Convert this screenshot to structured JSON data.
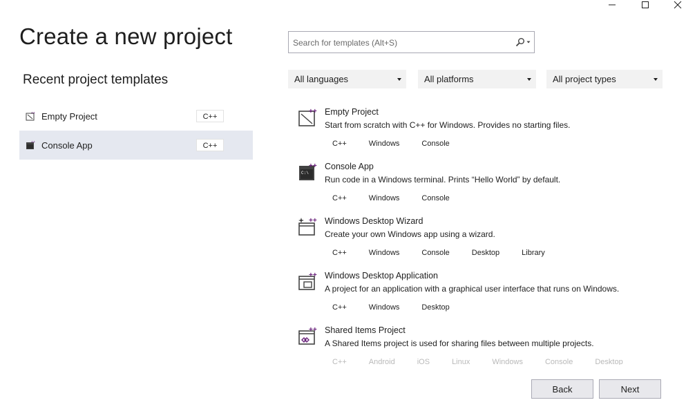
{
  "page": {
    "title": "Create a new project"
  },
  "recent": {
    "heading": "Recent project templates",
    "items": [
      {
        "label": "Empty Project",
        "badge": "C++",
        "icon": "empty-project-icon"
      },
      {
        "label": "Console App",
        "badge": "C++",
        "icon": "console-app-icon",
        "selected": true
      }
    ]
  },
  "search": {
    "placeholder": "Search for templates (Alt+S)",
    "value": ""
  },
  "filters": {
    "language": "All languages",
    "platform": "All platforms",
    "project_type": "All project types"
  },
  "templates": [
    {
      "name": "Empty Project",
      "description": "Start from scratch with C++ for Windows. Provides no starting files.",
      "tags": [
        "C++",
        "Windows",
        "Console"
      ],
      "icon": "empty-project-icon"
    },
    {
      "name": "Console App",
      "description": "Run code in a Windows terminal. Prints “Hello World” by default.",
      "tags": [
        "C++",
        "Windows",
        "Console"
      ],
      "icon": "console-app-icon"
    },
    {
      "name": "Windows Desktop Wizard",
      "description": "Create your own Windows app using a wizard.",
      "tags": [
        "C++",
        "Windows",
        "Console",
        "Desktop",
        "Library"
      ],
      "icon": "desktop-wizard-icon"
    },
    {
      "name": "Windows Desktop Application",
      "description": "A project for an application with a graphical user interface that runs on Windows.",
      "tags": [
        "C++",
        "Windows",
        "Desktop"
      ],
      "icon": "desktop-application-icon"
    },
    {
      "name": "Shared Items Project",
      "description": "A Shared Items project is used for sharing files between multiple projects.",
      "tags": [
        "C++",
        "Android",
        "iOS",
        "Linux",
        "Windows",
        "Console",
        "Desktop"
      ],
      "icon": "shared-items-icon"
    }
  ],
  "footer": {
    "back_label": "Back",
    "next_label": "Next"
  },
  "colors": {
    "selected_row": "#e5e8f0",
    "filter_bg": "#f2f2f2",
    "button_bg": "#e8e8ec",
    "accent_purple": "#68217a"
  }
}
